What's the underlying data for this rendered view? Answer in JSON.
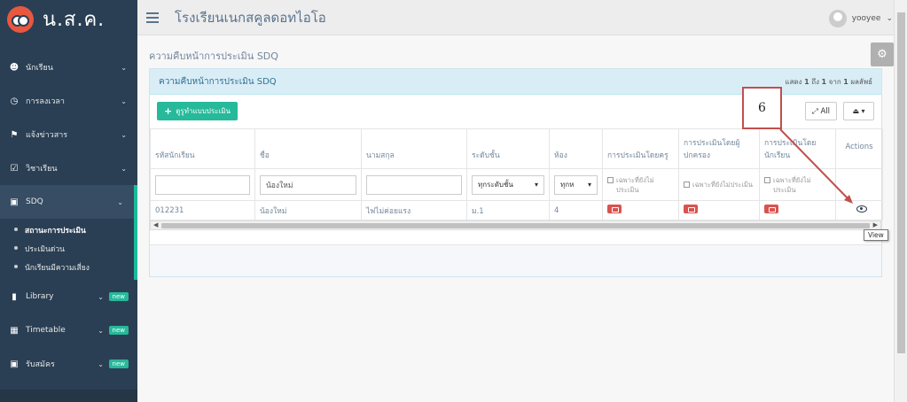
{
  "brand": {
    "name": "น.ส.ค."
  },
  "topnav": {
    "title": "โรงเรียนเนกสคูลดอทไอโอ",
    "user": "yooyee"
  },
  "sidebar": {
    "items": [
      {
        "label": "นักเรียน",
        "icon": "users-icon"
      },
      {
        "label": "การลงเวลา",
        "icon": "clock-icon"
      },
      {
        "label": "แจ้งข่าวสาร",
        "icon": "megaphone-icon"
      },
      {
        "label": "วิชาเรียน",
        "icon": "calendar-check-icon"
      },
      {
        "label": "SDQ",
        "icon": "id-card-icon"
      },
      {
        "label": "Library",
        "icon": "book-icon",
        "badge": "new"
      },
      {
        "label": "Timetable",
        "icon": "database-icon",
        "badge": "new"
      },
      {
        "label": "รับสมัคร",
        "icon": "id-card-icon",
        "badge": "new"
      }
    ],
    "sdq_sub": [
      "สถานะการประเมิน",
      "ประเมินด่วน",
      "นักเรียนมีความเสี่ยง"
    ]
  },
  "page": {
    "title": "ความคืบหน้าการประเมิน SDQ",
    "panel_title": "ความคืบหน้าการประเมิน SDQ",
    "records": {
      "pre": "แสดง",
      "from": "1",
      "to_word": "ถึง",
      "to": "1",
      "of_word": "จาก",
      "total": "1",
      "unit": "ผลลัพธ์"
    },
    "add_button": "ดูรูทำแบบประเมิน",
    "all_button": "All"
  },
  "table": {
    "headers": [
      "รหัสนักเรียน",
      "ชื่อ",
      "นามสกุล",
      "ระดับชั้น",
      "ห้อง",
      "การประเมินโดยครู",
      "การประเมินโดยผู้ปกครอง",
      "การประเมินโดยนักเรียน",
      "Actions"
    ],
    "filters": {
      "name": "น้องใหม่",
      "level": "ทุกระดับชั้น",
      "room": "ทุกห",
      "check_label": "เฉพาะที่ยังไม่ประเมิน"
    },
    "rows": [
      {
        "id": "012231",
        "first": "น้องใหม่",
        "last": "ไฟไม่ค่อยแรง",
        "level": "ม.1",
        "room": "4"
      }
    ]
  },
  "annotation": {
    "number": "6",
    "tooltip": "View"
  },
  "colors": {
    "sidebar": "#2a3f54",
    "accent": "#1abb9c",
    "annotation": "#c0504d",
    "danger": "#d9534f"
  }
}
